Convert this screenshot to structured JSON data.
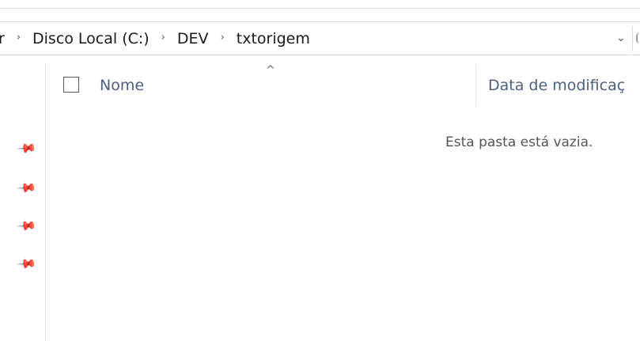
{
  "address": {
    "partial": "r",
    "crumbs": [
      "Disco Local (C:)",
      "DEV",
      "txtorigem"
    ],
    "separator": "›",
    "dropdown_icon": "chevron-down-icon"
  },
  "columns": {
    "name": "Nome",
    "date": "Data de modificaç"
  },
  "sort_icon": "^",
  "empty_message": "Esta pasta está vazia.",
  "quick_access_pins": 4
}
